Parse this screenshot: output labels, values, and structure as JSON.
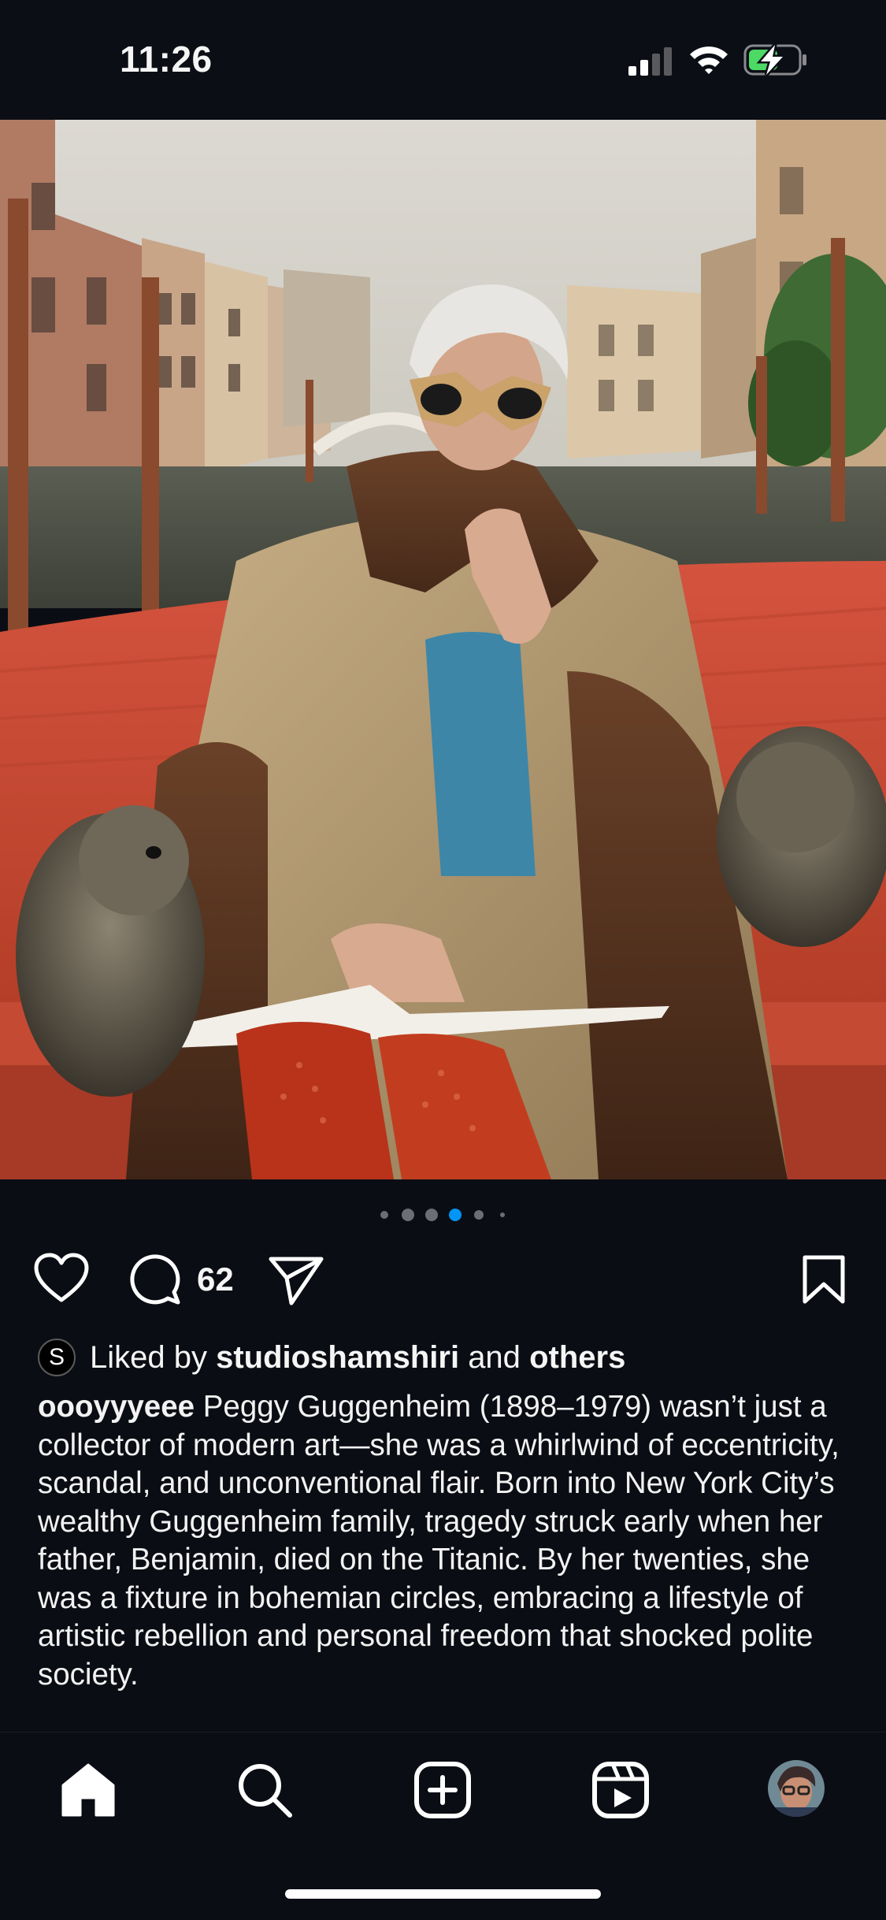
{
  "status_bar": {
    "time": "11:26",
    "icons": [
      "cellular-signal-icon",
      "wifi-icon",
      "battery-charging-icon"
    ],
    "battery_color": "#4cd964"
  },
  "post": {
    "carousel": {
      "dot_count": 6,
      "active_index": 3,
      "active_color": "#0095f6"
    },
    "actions": {
      "comment_count": "62"
    },
    "likes": {
      "avatar_letter": "S",
      "prefix": "Liked by",
      "user": "studioshamshiri",
      "connector": "and",
      "others": "others"
    },
    "caption": {
      "username": "oooyyyeee",
      "text": "Peggy Guggenheim (1898–1979) wasn’t just a collector of modern art—she was a whirlwind of eccentricity, scandal, and unconventional flair. Born into New York City’s wealthy Guggenheim family, tragedy struck early when her father, Benjamin, died on the Titanic. By her twenties, she was a fixture in bohemian circles, embracing a lifestyle of artistic rebellion and personal freedom that shocked polite society."
    }
  },
  "tab_bar": {
    "items": [
      "home-icon",
      "search-icon",
      "create-post-icon",
      "reels-icon",
      "profile-avatar"
    ],
    "active": "home-icon"
  }
}
